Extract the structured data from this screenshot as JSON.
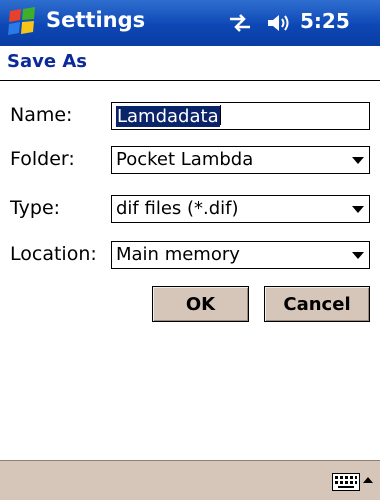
{
  "titlebar": {
    "app_title": "Settings",
    "clock": "5:25",
    "icons": [
      "windows-start-icon",
      "connectivity-icon",
      "speaker-icon"
    ]
  },
  "dialog": {
    "title": "Save As"
  },
  "form": {
    "name_label": "Name:",
    "name_value": "Lamdadata",
    "folder_label": "Folder:",
    "folder_value": "Pocket Lambda",
    "type_label": "Type:",
    "type_value": "dif files (*.dif)",
    "location_label": "Location:",
    "location_value": "Main memory"
  },
  "buttons": {
    "ok_label": "OK",
    "cancel_label": "Cancel"
  },
  "menubar": {
    "icons": [
      "keyboard-icon",
      "input-panel-arrow-icon"
    ]
  },
  "colors": {
    "titlebar": "#0d47b5",
    "dialog_title": "#0a2a9a",
    "selection": "#0a246a",
    "button_face": "#d6c6b9"
  }
}
